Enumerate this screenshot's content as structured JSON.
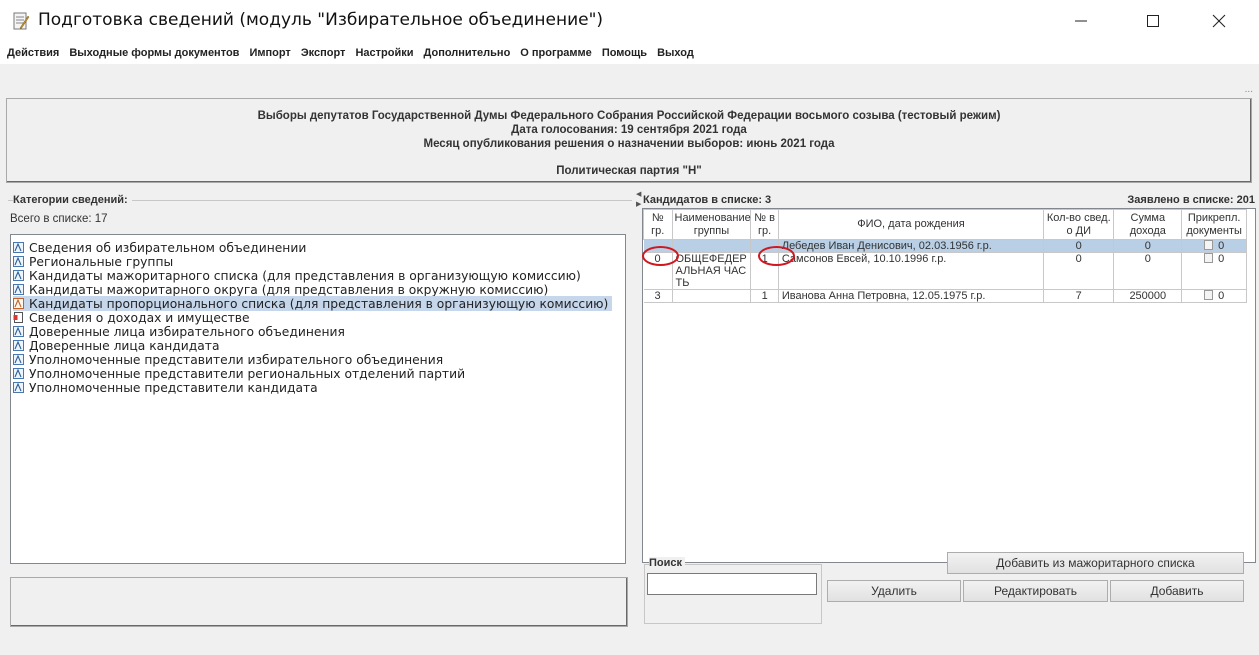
{
  "window": {
    "title": "Подготовка сведений (модуль \"Избирательное объединение\")"
  },
  "menu": [
    "Действия",
    "Выходные формы документов",
    "Импорт",
    "Экспорт",
    "Настройки",
    "Дополнительно",
    "О программе",
    "Помощь",
    "Выход"
  ],
  "header": {
    "line1": "Выборы депутатов Государственной Думы Федерального Собрания Российской Федерации восьмого созыва (тестовый режим)",
    "line2": "Дата голосования: 19 сентября 2021 года",
    "line3": "Месяц опубликования решения о назначении выборов: июнь 2021 года",
    "line4": "Политическая партия \"Н\"",
    "more": "..."
  },
  "categories": {
    "legend": "Категории сведений:",
    "total": "Всего в списке:  17",
    "items": [
      "Сведения об избирательном объединении",
      "Региональные группы",
      "Кандидаты мажоритарного списка (для представления в организующую комиссию)",
      "Кандидаты мажоритарного округа (для представления в окружную комиссию)",
      "Кандидаты пропорционального списка (для представления в организующую комиссию)",
      "Сведения о доходах и имуществе",
      "Доверенные лица избирательного объединения",
      "Доверенные лица кандидата",
      "Уполномоченные представители избирательного объединения",
      "Уполномоченные представители региональных отделений партий",
      "Уполномоченные представители кандидата"
    ],
    "selected_index": 4
  },
  "candidates": {
    "count_label": "Кандидатов в списке: 3",
    "declared_label": "Заявлено в списке: 201",
    "columns": [
      "№ гр.",
      "Наименование группы",
      "№ в гр.",
      "ФИО, дата рождения",
      "Кол-во свед. о ДИ",
      "Сумма дохода",
      "Прикрепл. документы"
    ],
    "rows": [
      {
        "gr": "",
        "group": "",
        "num": "",
        "fio": "Лебедев Иван Денисович, 02.03.1956 г.р.",
        "di": "0",
        "income": "0",
        "docs": "0"
      },
      {
        "gr": "0",
        "group": "ОБЩЕФЕДЕРАЛЬНАЯ ЧАСТЬ",
        "num": "1",
        "fio": "Самсонов Евсей, 10.10.1996 г.р.",
        "di": "0",
        "income": "0",
        "docs": "0"
      },
      {
        "gr": "3",
        "group": "",
        "num": "1",
        "fio": "Иванова Анна Петровна, 12.05.1975 г.р.",
        "di": "7",
        "income": "250000",
        "docs": "0"
      }
    ],
    "selected_row": 0
  },
  "search": {
    "legend": "Поиск",
    "value": ""
  },
  "buttons": {
    "add_from_major": "Добавить из мажоритарного списка",
    "delete": "Удалить",
    "edit": "Редактировать",
    "add": "Добавить"
  },
  "colors": {
    "selection": "#c6d7ec",
    "annotation_circle": "#d01820"
  }
}
